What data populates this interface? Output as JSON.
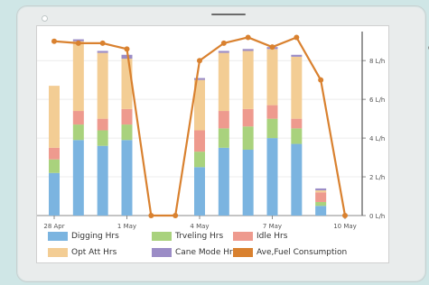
{
  "chart_data": {
    "type": "bar",
    "categories": [
      "28 Apr",
      "29 Apr",
      "30 Apr",
      "1 May",
      "2 May",
      "3 May",
      "4 May",
      "5 May",
      "6 May",
      "7 May",
      "8 May",
      "9 May",
      "10 May"
    ],
    "x_ticks": [
      "28 Apr",
      "1 May",
      "4 May",
      "7 May",
      "10 May"
    ],
    "y_ticks": [
      "0 L/h",
      "2 L/h",
      "4 L/h",
      "6 L/h",
      "8 L/h"
    ],
    "y_range": [
      0,
      9.5
    ],
    "stacked": true,
    "series": [
      {
        "name": "Digging Hrs",
        "color": "#7bb4e0",
        "values": [
          2.2,
          3.9,
          3.6,
          3.9,
          0,
          0,
          2.5,
          3.5,
          3.4,
          4.0,
          3.7,
          0.5,
          0
        ]
      },
      {
        "name": "Trveling Hrs",
        "color": "#a9d27d",
        "values": [
          0.7,
          0.8,
          0.8,
          0.8,
          0,
          0,
          0.8,
          1.0,
          1.2,
          1.0,
          0.8,
          0.2,
          0
        ]
      },
      {
        "name": "Idle Hrs",
        "color": "#ee9a8e",
        "values": [
          0.6,
          0.7,
          0.6,
          0.8,
          0,
          0,
          1.1,
          0.9,
          0.9,
          0.7,
          0.5,
          0.5,
          0
        ]
      },
      {
        "name": "Opt Att Hrs",
        "color": "#f3cd94",
        "values": [
          3.2,
          3.6,
          3.4,
          2.6,
          0,
          0,
          2.6,
          3.0,
          3.0,
          2.9,
          3.2,
          0.1,
          0
        ]
      },
      {
        "name": "Cane Mode Hrs",
        "color": "#9b8cc6",
        "values": [
          0,
          0.1,
          0.1,
          0.2,
          0,
          0,
          0.1,
          0.1,
          0.1,
          0.1,
          0.1,
          0.1,
          0
        ]
      }
    ],
    "line": {
      "name": "Ave,Fuel Consumption",
      "color": "#d9812f",
      "values": [
        9.0,
        8.9,
        8.9,
        8.6,
        0,
        0,
        8.0,
        8.9,
        9.2,
        8.7,
        9.2,
        7.0,
        0
      ]
    }
  }
}
